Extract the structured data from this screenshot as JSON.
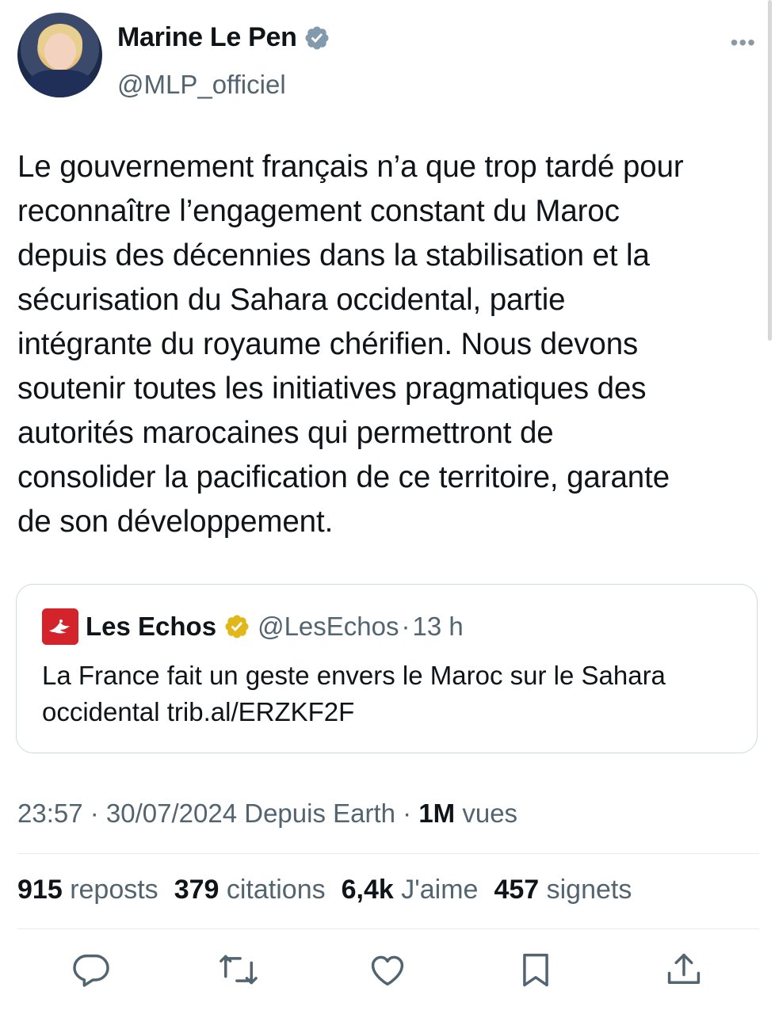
{
  "author": {
    "name": "Marine Le Pen",
    "handle": "@MLP_officiel",
    "more_label": "•••",
    "avatar_icon": "profile-photo"
  },
  "tweet": {
    "text": "Le gouvernement français n’a que trop tardé pour\nreconnaître l’engagement constant du Maroc\ndepuis des décennies dans la stabilisation et la\nsécurisation  du Sahara occidental, partie\nintégrante du royaume chérifien. Nous devons\nsoutenir toutes les initiatives pragmatiques des\nautorités marocaines qui permettront de\nconsolider la pacification de ce territoire, garante\nde son développement."
  },
  "quote": {
    "name": "Les Echos",
    "handle": "@LesEchos",
    "dot": "·",
    "time": "13 h",
    "text": "La France fait un geste envers le Maroc sur le Sahara occidental trib.al/ERZKF2F",
    "logo_color": "#d3242b"
  },
  "meta": {
    "datetime": "23:57 · 30/07/2024 Depuis Earth · ",
    "views_value": "1M",
    "views_label": " vues"
  },
  "stats": [
    {
      "value": "915",
      "label": "reposts"
    },
    {
      "value": "379",
      "label": "citations"
    },
    {
      "value": "6,4k",
      "label": "J'aime"
    },
    {
      "value": "457",
      "label": "signets"
    }
  ],
  "actions": [
    "reply-icon",
    "repost-icon",
    "like-icon",
    "bookmark-icon",
    "share-icon"
  ],
  "colors": {
    "verified_blue": "#829aab",
    "verified_gold": "#e2b719",
    "secondary_text": "#536471"
  }
}
